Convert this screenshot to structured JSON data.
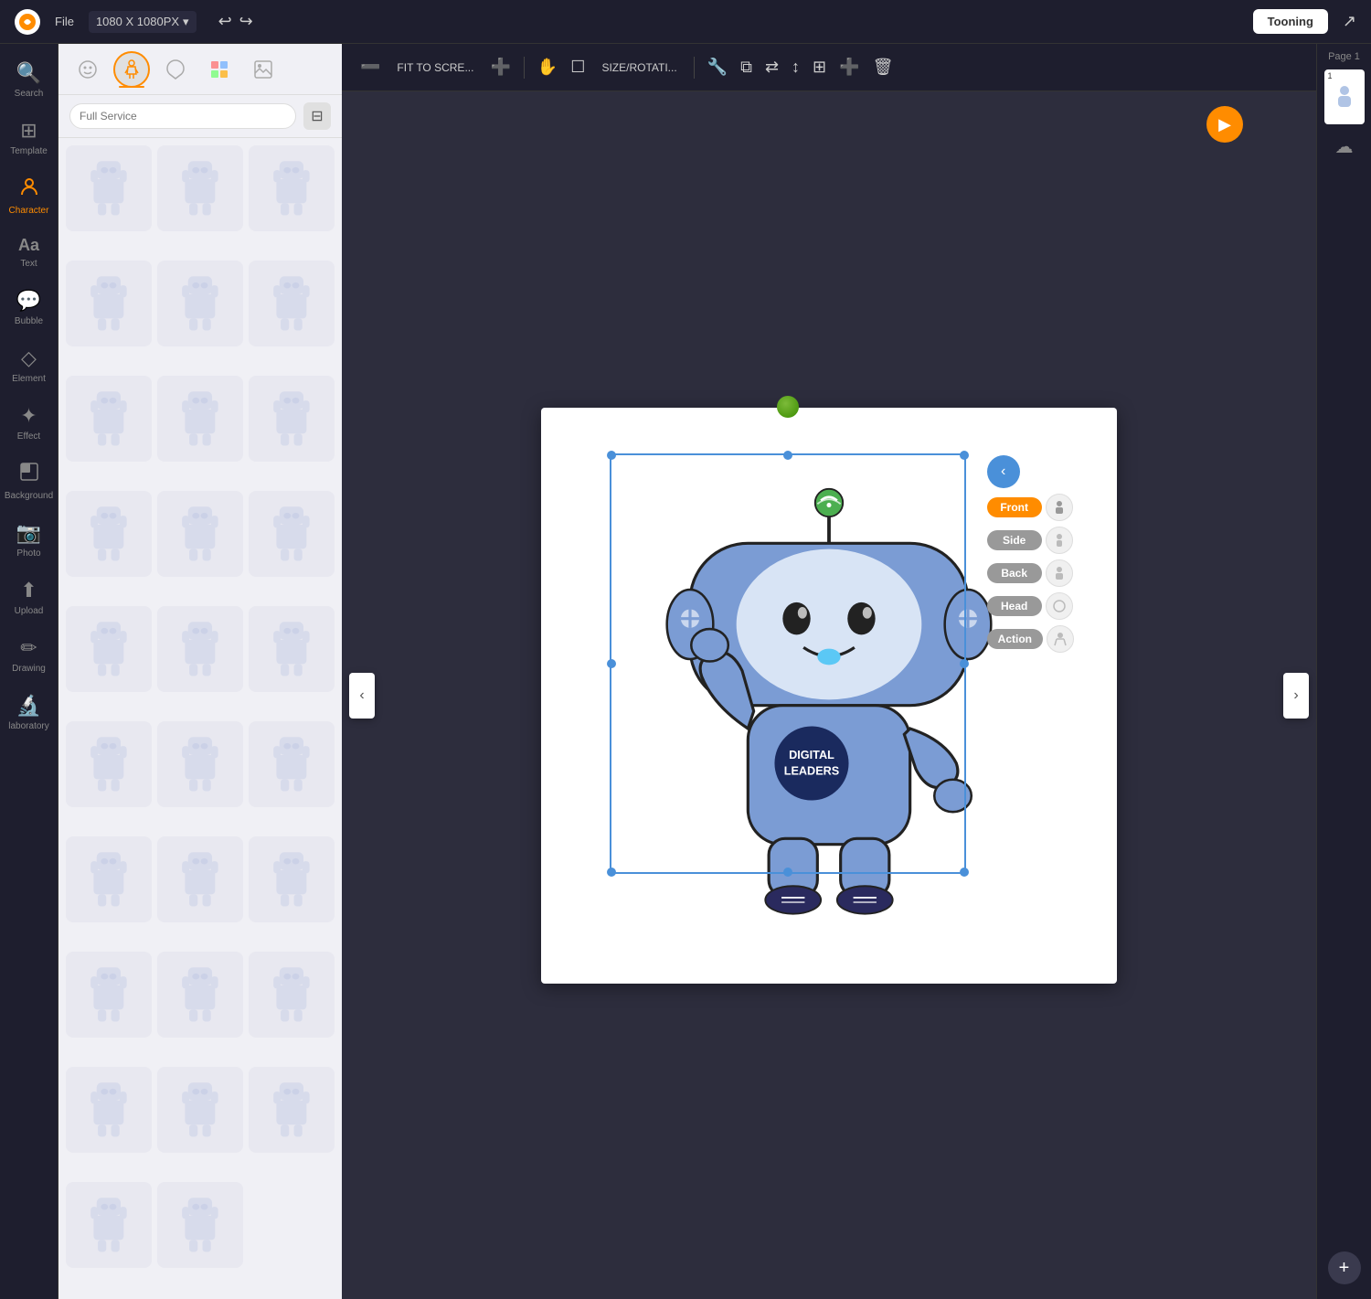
{
  "topbar": {
    "file_label": "File",
    "size_label": "1080 X 1080PX",
    "tooning_label": "Tooning",
    "undo_icon": "↩",
    "redo_icon": "↪",
    "chevron_icon": "▾"
  },
  "sidebar": {
    "items": [
      {
        "id": "search",
        "label": "Search",
        "icon": "🔍"
      },
      {
        "id": "template",
        "label": "Template",
        "icon": "⊞"
      },
      {
        "id": "character",
        "label": "Character",
        "icon": "👤",
        "active": true
      },
      {
        "id": "text",
        "label": "Text",
        "icon": "Aa"
      },
      {
        "id": "bubble",
        "label": "Bubble",
        "icon": "💬"
      },
      {
        "id": "element",
        "label": "Element",
        "icon": "◇"
      },
      {
        "id": "effect",
        "label": "Effect",
        "icon": "✦"
      },
      {
        "id": "background",
        "label": "Background",
        "icon": "🖼"
      },
      {
        "id": "photo",
        "label": "Photo",
        "icon": "📷"
      },
      {
        "id": "upload",
        "label": "Upload",
        "icon": "⬆"
      },
      {
        "id": "drawing",
        "label": "Drawing",
        "icon": "✏"
      },
      {
        "id": "laboratory",
        "label": "laboratory",
        "icon": "🔬"
      }
    ]
  },
  "panel": {
    "tools": [
      {
        "id": "face",
        "icon": "😊",
        "active": false
      },
      {
        "id": "body",
        "icon": "🤖",
        "active": true
      },
      {
        "id": "style",
        "icon": "🎨",
        "active": false
      },
      {
        "id": "color",
        "icon": "🎨",
        "active": false
      },
      {
        "id": "image",
        "icon": "🖼",
        "active": false
      }
    ],
    "search_placeholder": "Full Service",
    "characters": [
      {
        "id": 1
      },
      {
        "id": 2
      },
      {
        "id": 3
      },
      {
        "id": 4
      },
      {
        "id": 5
      },
      {
        "id": 6
      },
      {
        "id": 7
      },
      {
        "id": 8
      },
      {
        "id": 9
      },
      {
        "id": 10
      },
      {
        "id": 11
      },
      {
        "id": 12
      },
      {
        "id": 13
      },
      {
        "id": 14
      },
      {
        "id": 15
      },
      {
        "id": 16
      },
      {
        "id": 17
      },
      {
        "id": 18
      },
      {
        "id": 19
      },
      {
        "id": 20
      },
      {
        "id": 21
      },
      {
        "id": 22
      },
      {
        "id": 23
      },
      {
        "id": 24
      },
      {
        "id": 25
      },
      {
        "id": 26
      },
      {
        "id": 27
      },
      {
        "id": 28
      },
      {
        "id": 29
      },
      {
        "id": 30
      }
    ]
  },
  "canvas": {
    "fit_label": "FIT TO SCRE...",
    "size_rot_label": "SIZE/ROTATI...",
    "zoom_out_icon": "➖",
    "zoom_in_icon": "➕",
    "hand_icon": "✋",
    "crop_icon": "⧉",
    "character": {
      "badge_text": "DIGITAL\nLEADERS"
    }
  },
  "pose_panel": {
    "toggle_icon": "‹",
    "options": [
      {
        "label": "Front",
        "active": true
      },
      {
        "label": "Side",
        "active": false
      },
      {
        "label": "Back",
        "active": false
      },
      {
        "label": "Head",
        "active": false
      },
      {
        "label": "Action",
        "active": false
      }
    ]
  },
  "right_panel": {
    "page_label": "Page 1",
    "page_num": "1",
    "add_icon": "+"
  }
}
